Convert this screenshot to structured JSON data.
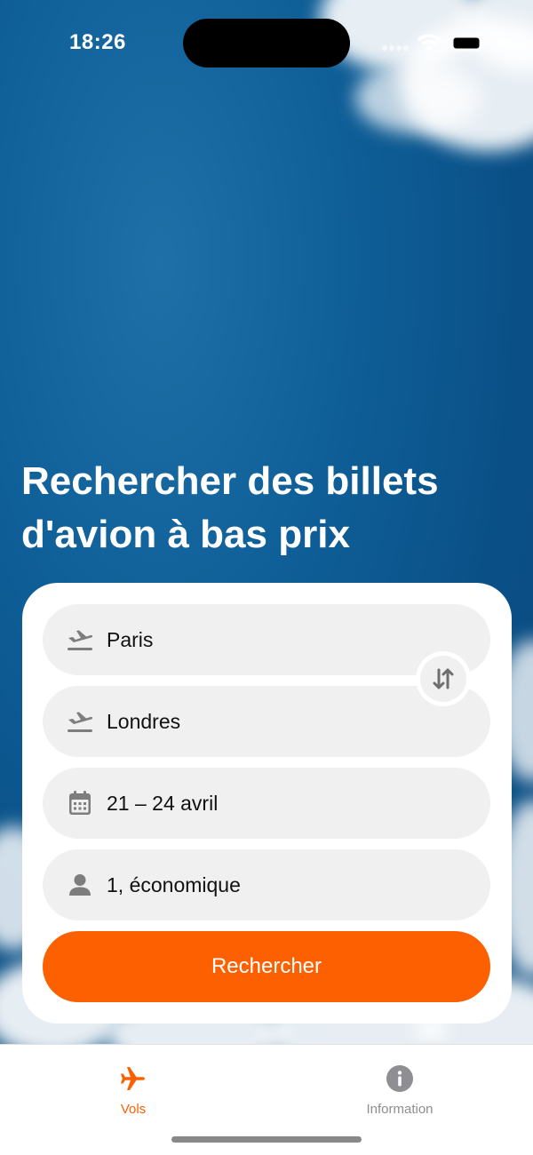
{
  "status_bar": {
    "time": "18:26"
  },
  "hero": {
    "title": "Rechercher des billets d'avion à bas prix"
  },
  "search_form": {
    "origin": {
      "value": "Paris",
      "icon": "plane-departure-icon"
    },
    "destination": {
      "value": "Londres",
      "icon": "plane-departure-icon"
    },
    "dates": {
      "value": "21 – 24 avril",
      "icon": "calendar-icon"
    },
    "passengers": {
      "value": "1, économique",
      "icon": "person-icon"
    },
    "swap_icon": "swap-arrows-icon",
    "search_label": "Rechercher"
  },
  "tab_bar": {
    "tabs": [
      {
        "label": "Vols",
        "icon": "airplane-icon",
        "active": true
      },
      {
        "label": "Information",
        "icon": "info-icon",
        "active": false
      }
    ]
  },
  "colors": {
    "accent": "#fd6000",
    "sky": "#0f5f98",
    "field_bg": "#f0f0f0",
    "inactive_tab": "#8e8e93"
  }
}
